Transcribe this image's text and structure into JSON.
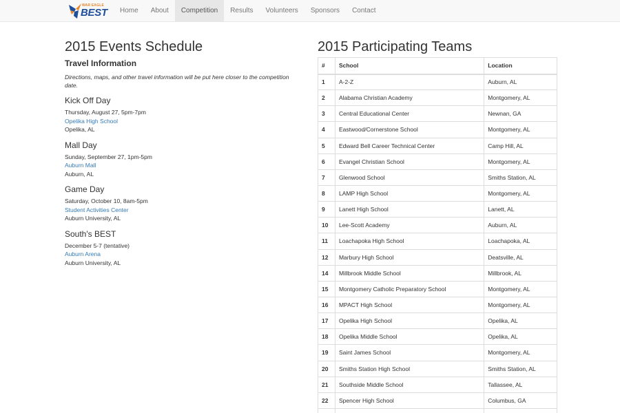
{
  "brand": {
    "small_text": "WAR EAGLE",
    "big_text": "BEST",
    "colors": {
      "orange": "#e8862a",
      "blue": "#1f4e9a"
    }
  },
  "nav": {
    "items": [
      {
        "label": "Home"
      },
      {
        "label": "About"
      },
      {
        "label": "Competition",
        "active": true
      },
      {
        "label": "Results"
      },
      {
        "label": "Volunteers"
      },
      {
        "label": "Sponsors"
      },
      {
        "label": "Contact"
      }
    ]
  },
  "schedule": {
    "title": "2015 Events Schedule",
    "travel_heading": "Travel Information",
    "travel_note": "Directions, maps, and other travel information will be put here closer to the competition date.",
    "events": [
      {
        "title": "Kick Off Day",
        "when": "Thursday, August 27, 5pm-7pm",
        "venue": "Opelika High School",
        "place": "Opelika, AL"
      },
      {
        "title": "Mall Day",
        "when": "Sunday, September 27, 1pm-5pm",
        "venue": "Auburn Mall",
        "place": "Auburn, AL"
      },
      {
        "title": "Game Day",
        "when": "Saturday, October 10, 8am-5pm",
        "venue": "Student Activities Center",
        "place": "Auburn University, AL"
      },
      {
        "title": "South's BEST",
        "when": "December 5-7 (tentative)",
        "venue": "Auburn Arena",
        "place": "Auburn University, AL"
      }
    ]
  },
  "teams": {
    "title": "2015 Participating Teams",
    "headers": {
      "num": "#",
      "school": "School",
      "location": "Location"
    },
    "rows": [
      {
        "num": "1",
        "school": "A-2-Z",
        "location": "Auburn, AL"
      },
      {
        "num": "2",
        "school": "Alabama Christian Academy",
        "location": "Montgomery, AL"
      },
      {
        "num": "3",
        "school": "Central Educational Center",
        "location": "Newnan, GA"
      },
      {
        "num": "4",
        "school": "Eastwood/Cornerstone School",
        "location": "Montgomery, AL"
      },
      {
        "num": "5",
        "school": "Edward Bell Career Technical Center",
        "location": "Camp Hill, AL"
      },
      {
        "num": "6",
        "school": "Evangel Christian School",
        "location": "Montgomery, AL"
      },
      {
        "num": "7",
        "school": "Glenwood School",
        "location": "Smiths Station, AL"
      },
      {
        "num": "8",
        "school": "LAMP High School",
        "location": "Montgomery, AL"
      },
      {
        "num": "9",
        "school": "Lanett High School",
        "location": "Lanett, AL"
      },
      {
        "num": "10",
        "school": "Lee-Scott Academy",
        "location": "Auburn, AL"
      },
      {
        "num": "11",
        "school": "Loachapoka High School",
        "location": "Loachapoka, AL"
      },
      {
        "num": "12",
        "school": "Marbury High School",
        "location": "Deatsville, AL"
      },
      {
        "num": "14",
        "school": "Millbrook Middle School",
        "location": "Millbrook, AL"
      },
      {
        "num": "15",
        "school": "Montgomery Catholic Preparatory School",
        "location": "Montgomery, AL"
      },
      {
        "num": "16",
        "school": "MPACT High School",
        "location": "Montgomery, AL"
      },
      {
        "num": "17",
        "school": "Opelika High School",
        "location": "Opelika, AL"
      },
      {
        "num": "18",
        "school": "Opelika Middle School",
        "location": "Opelika, AL"
      },
      {
        "num": "19",
        "school": "Saint James School",
        "location": "Montgomery, AL"
      },
      {
        "num": "20",
        "school": "Smiths Station High School",
        "location": "Smiths Station, AL"
      },
      {
        "num": "21",
        "school": "Southside Middle School",
        "location": "Tallassee, AL"
      },
      {
        "num": "22",
        "school": "Spencer High School",
        "location": "Columbus, GA"
      },
      {
        "num": "",
        "school": "",
        "location": ""
      }
    ]
  }
}
